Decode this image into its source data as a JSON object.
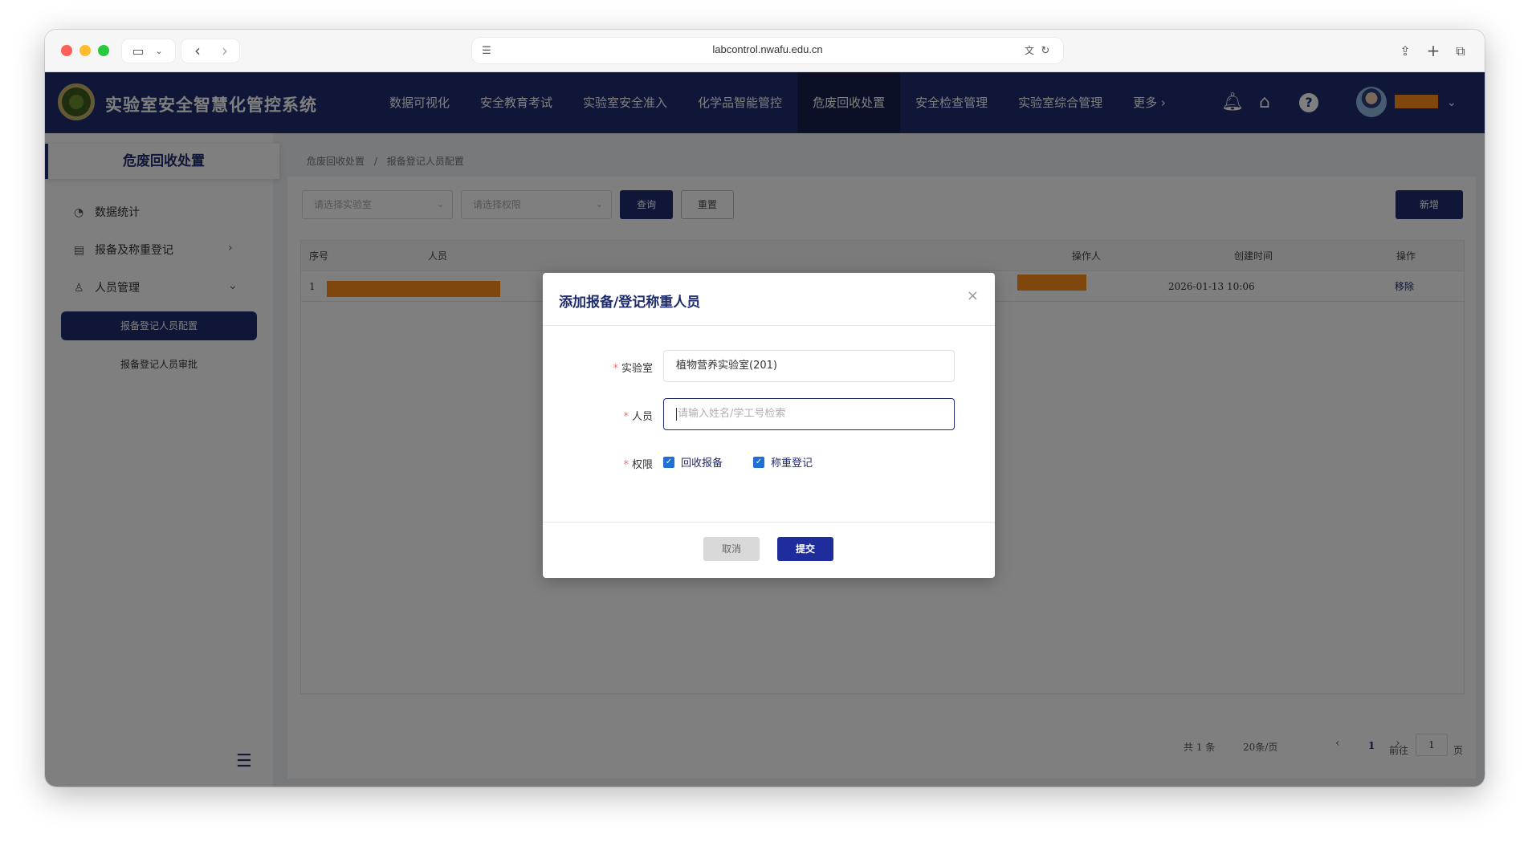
{
  "browser": {
    "url": "labcontrol.nwafu.edu.cn"
  },
  "app": {
    "title": "实验室安全智慧化管控系统",
    "nav": [
      {
        "label": "数据可视化"
      },
      {
        "label": "安全教育考试"
      },
      {
        "label": "实验室安全准入"
      },
      {
        "label": "化学品智能管控"
      },
      {
        "label": "危废回收处置",
        "active": true
      },
      {
        "label": "安全检查管理"
      },
      {
        "label": "实验室综合管理"
      },
      {
        "label": "更多 ›"
      }
    ],
    "colors": {
      "primary": "#1e2c6e",
      "redaction": "#ff8c1a",
      "required": "#f56c6c",
      "checkbox": "#1e6fd6"
    }
  },
  "sidebar": {
    "title": "危废回收处置",
    "items": [
      {
        "label": "数据统计",
        "icon": "pie-chart-icon"
      },
      {
        "label": "报备及称重登记",
        "icon": "document-icon"
      },
      {
        "label": "人员管理",
        "icon": "user-icon"
      }
    ],
    "sub_items": [
      {
        "label": "报备登记人员配置",
        "active": true
      },
      {
        "label": "报备登记人员审批"
      }
    ]
  },
  "breadcrumb": {
    "root": "危废回收处置",
    "separator": "/",
    "current": "报备登记人员配置"
  },
  "filters": {
    "lab_placeholder": "请选择实验室",
    "perm_placeholder": "请选择权限",
    "query_label": "查询",
    "reset_label": "重置",
    "add_label": "新增"
  },
  "table": {
    "headers": [
      "序号",
      "人员",
      "操作人",
      "创建时间",
      "操作"
    ],
    "rows": [
      {
        "index": "1",
        "created": "2026-01-13 10:06",
        "action": "移除"
      }
    ]
  },
  "pager": {
    "total": "共 1 条",
    "page_size": "20条/页",
    "prev": "‹",
    "current": "1",
    "next": "›",
    "goto_prefix": "前往",
    "goto_value": "1",
    "goto_suffix": "页"
  },
  "dialog": {
    "title": "添加报备/登记称重人员",
    "close": "×",
    "lab_label": "实验室",
    "lab_value": "植物营养实验室(201)",
    "person_label": "人员",
    "person_placeholder": "请输入姓名/学工号检索",
    "perm_label": "权限",
    "perm_options": [
      {
        "label": "回收报备",
        "checked": true
      },
      {
        "label": "称重登记",
        "checked": true
      }
    ],
    "required_mark": "*",
    "cancel_label": "取消",
    "submit_label": "提交"
  }
}
